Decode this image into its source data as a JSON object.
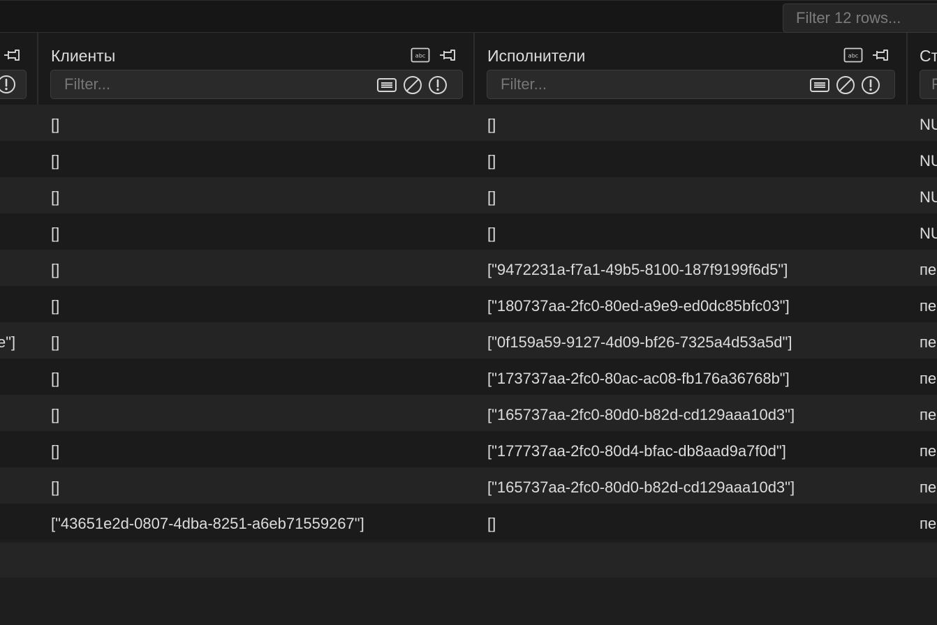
{
  "toolbar": {
    "filter_placeholder": "Filter 12 rows..."
  },
  "columns": {
    "clients": {
      "title": "Клиенты",
      "filter_placeholder": "Filter..."
    },
    "executors": {
      "title": "Исполнители",
      "filter_placeholder": "Filter..."
    },
    "next": {
      "title": "Ст",
      "filter_placeholder": "F"
    }
  },
  "rows": [
    {
      "prev": "",
      "clients": "[]",
      "executors": "[]",
      "next": "NU"
    },
    {
      "prev": "",
      "clients": "[]",
      "executors": "[]",
      "next": "NU"
    },
    {
      "prev": "",
      "clients": "[]",
      "executors": "[]",
      "next": "NU"
    },
    {
      "prev": "",
      "clients": "[]",
      "executors": "[]",
      "next": "NU"
    },
    {
      "prev": "",
      "clients": "[]",
      "executors": "[\"9472231a-f7a1-49b5-8100-187f9199f6d5\"]",
      "next": "пе"
    },
    {
      "prev": "",
      "clients": "[]",
      "executors": "[\"180737aa-2fc0-80ed-a9e9-ed0dc85bfc03\"]",
      "next": "пе"
    },
    {
      "prev": "e\"]",
      "clients": "[]",
      "executors": "[\"0f159a59-9127-4d09-bf26-7325a4d53a5d\"]",
      "next": "пе"
    },
    {
      "prev": "",
      "clients": "[]",
      "executors": "[\"173737aa-2fc0-80ac-ac08-fb176a36768b\"]",
      "next": "пе"
    },
    {
      "prev": "",
      "clients": "[]",
      "executors": "[\"165737aa-2fc0-80d0-b82d-cd129aaa10d3\"]",
      "next": "пе"
    },
    {
      "prev": "",
      "clients": "[]",
      "executors": "[\"177737aa-2fc0-80d4-bfac-db8aad9a7f0d\"]",
      "next": "пе"
    },
    {
      "prev": "",
      "clients": "[]",
      "executors": "[\"165737aa-2fc0-80d0-b82d-cd129aaa10d3\"]",
      "next": "пе"
    },
    {
      "prev": "",
      "clients": "[\"43651e2d-0807-4dba-8251-a6eb71559267\"]",
      "executors": "[]",
      "next": "пе"
    }
  ]
}
